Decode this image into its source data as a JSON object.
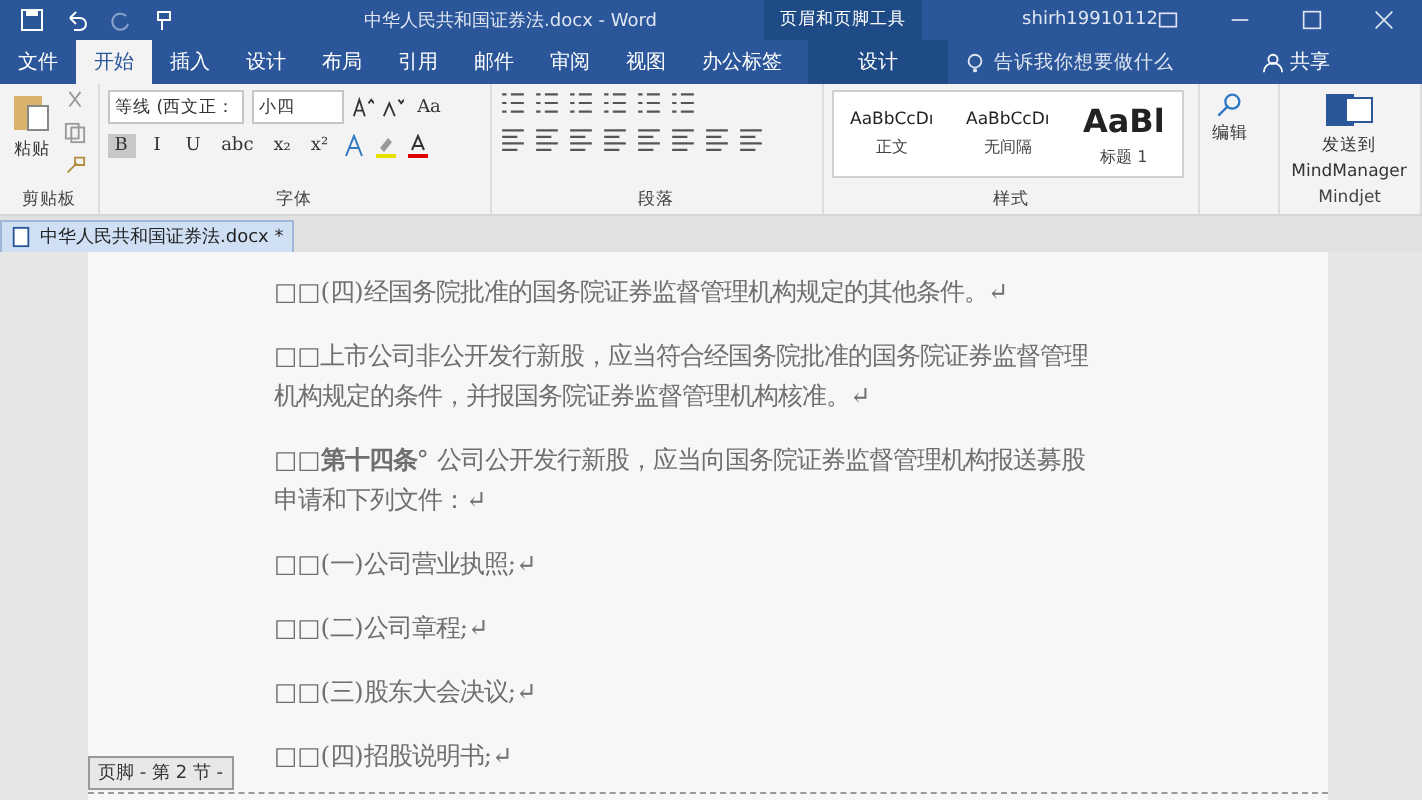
{
  "title_bar": {
    "title": "中华人民共和国证券法.docx - Word",
    "context_label": "页眉和页脚工具",
    "user": "shirh19910112"
  },
  "menu_tabs": [
    {
      "label": "文件",
      "selected": false
    },
    {
      "label": "开始",
      "selected": true
    },
    {
      "label": "插入",
      "selected": false
    },
    {
      "label": "设计",
      "selected": false
    },
    {
      "label": "布局",
      "selected": false
    },
    {
      "label": "引用",
      "selected": false
    },
    {
      "label": "邮件",
      "selected": false
    },
    {
      "label": "审阅",
      "selected": false
    },
    {
      "label": "视图",
      "selected": false
    },
    {
      "label": "办公标签",
      "selected": false
    }
  ],
  "context_tab": {
    "label": "设计",
    "selected": false
  },
  "tell_me": {
    "placeholder": "告诉我你想要做什么"
  },
  "share": "共享",
  "ribbon": {
    "clipboard": {
      "paste": "粘贴",
      "label": "剪贴板"
    },
    "font": {
      "font_name": "等线 (西文正：",
      "font_size": "小四",
      "case_button": "Aa",
      "format_buttons": [
        "B",
        "I",
        "U",
        "abc",
        "x₂",
        "x²"
      ],
      "label": "字体"
    },
    "paragraph": {
      "label": "段落"
    },
    "styles": {
      "items": [
        {
          "preview": "AaBbCcDı",
          "name": "正文",
          "kind": "normal"
        },
        {
          "preview": "AaBbCcDı",
          "name": "无间隔",
          "kind": "normal"
        },
        {
          "preview": "AaBl",
          "name": "标题 1",
          "kind": "heading"
        }
      ],
      "label": "样式"
    },
    "editing": {
      "label": "编辑"
    },
    "mindjet": {
      "line1": "发送到",
      "line2": "MindManager",
      "label": "Mindjet"
    }
  },
  "doc_tab": {
    "label": "中华人民共和国证券法.docx *"
  },
  "paragraphs": [
    "□□(四)经国务院批准的国务院证券监督管理机构规定的其他条件。↵",
    "□□上市公司非公开发行新股，应当符合经国务院批准的国务院证券监督管理机构规定的条件，并报国务院证券监督管理机构核准。↵",
    "□□**第十四条**° 公司公开发行新股，应当向国务院证券监督管理机构报送募股申请和下列文件：↵",
    "□□(一)公司营业执照;↵",
    "□□(二)公司章程;↵",
    "□□(三)股东大会决议;↵",
    "□□(四)招股说明书;↵"
  ],
  "footer_tag": "页脚 - 第 2 节 -"
}
